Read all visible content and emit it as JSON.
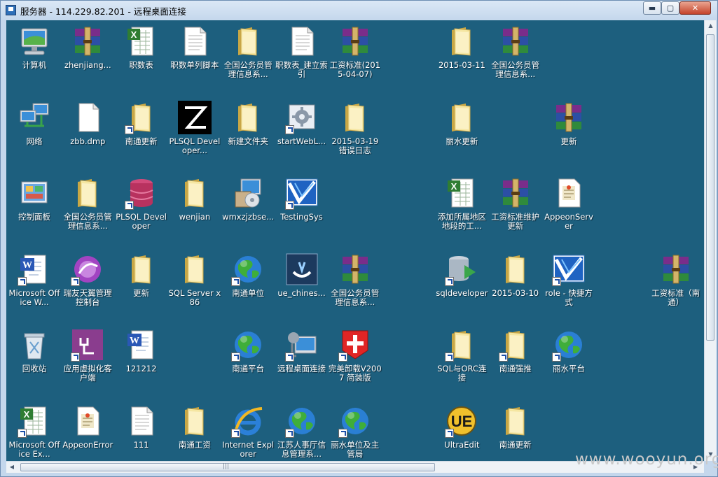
{
  "window": {
    "title": "服务器 - 114.229.82.201 - 远程桌面连接",
    "min_label": "▬",
    "max_label": "▢",
    "close_label": "✕"
  },
  "icons": [
    {
      "label": "计算机",
      "type": "computer",
      "shortcut": false
    },
    {
      "label": "zhenjiang...",
      "type": "rar",
      "shortcut": false
    },
    {
      "label": "职数表",
      "type": "excel",
      "shortcut": false
    },
    {
      "label": "职数单列脚本",
      "type": "doc",
      "shortcut": false
    },
    {
      "label": "全国公务员管理信息系...",
      "type": "folder",
      "shortcut": false
    },
    {
      "label": "职数表_建立索引",
      "type": "doc",
      "shortcut": false
    },
    {
      "label": "工资标准(2015-04-07)",
      "type": "rar",
      "shortcut": false
    },
    {
      "label": "2015-03-11",
      "type": "folder",
      "shortcut": false
    },
    {
      "label": "全国公务员管理信息系...",
      "type": "rar",
      "shortcut": false
    },
    {
      "label": "网络",
      "type": "network",
      "shortcut": false
    },
    {
      "label": "zbb.dmp",
      "type": "blank",
      "shortcut": false
    },
    {
      "label": "南通更新",
      "type": "folder",
      "shortcut": true
    },
    {
      "label": "PLSQL Developer...",
      "type": "plsql",
      "shortcut": false
    },
    {
      "label": "新建文件夹",
      "type": "folder",
      "shortcut": false
    },
    {
      "label": "startWebL...",
      "type": "gear",
      "shortcut": true
    },
    {
      "label": "2015-03-19错误日志",
      "type": "folder",
      "shortcut": false
    },
    {
      "label": "丽水更新",
      "type": "folder",
      "shortcut": false
    },
    {
      "label": "更新",
      "type": "rar",
      "shortcut": false
    },
    {
      "label": "控制面板",
      "type": "panel",
      "shortcut": false
    },
    {
      "label": "全国公务员管理信息系...",
      "type": "folder",
      "shortcut": false
    },
    {
      "label": "PLSQL Developer",
      "type": "database",
      "shortcut": true
    },
    {
      "label": "wenjian",
      "type": "folder",
      "shortcut": false
    },
    {
      "label": "wmxzjzbse...",
      "type": "installer",
      "shortcut": false
    },
    {
      "label": "TestingSys",
      "type": "app",
      "shortcut": true
    },
    {
      "label": "添加所属地区地段的工...",
      "type": "excel",
      "shortcut": false
    },
    {
      "label": "工资标准维护更新",
      "type": "rar",
      "shortcut": false
    },
    {
      "label": "AppeonServer",
      "type": "docfile",
      "shortcut": false
    },
    {
      "label": "Microsoft Office W...",
      "type": "word",
      "shortcut": true
    },
    {
      "label": "瑞友天翼管理控制台",
      "type": "purple",
      "shortcut": true
    },
    {
      "label": "更新",
      "type": "folder",
      "shortcut": false
    },
    {
      "label": "SQL Server x86",
      "type": "folder",
      "shortcut": false
    },
    {
      "label": "南通单位",
      "type": "globe",
      "shortcut": true
    },
    {
      "label": "ue_chines...",
      "type": "ue",
      "shortcut": false
    },
    {
      "label": "全国公务员管理信息系...",
      "type": "rar",
      "shortcut": false
    },
    {
      "label": "sqldeveloper",
      "type": "sqldev",
      "shortcut": true
    },
    {
      "label": "2015-03-10",
      "type": "folder",
      "shortcut": false
    },
    {
      "label": "role - 快捷方式",
      "type": "app",
      "shortcut": true
    },
    {
      "label": "工资标准（南通）",
      "type": "rar",
      "shortcut": false
    },
    {
      "label": "回收站",
      "type": "recycle",
      "shortcut": false
    },
    {
      "label": "应用虚拟化客户端",
      "type": "plug",
      "shortcut": true
    },
    {
      "label": "121212",
      "type": "word",
      "shortcut": false
    },
    {
      "label": "南通平台",
      "type": "globe",
      "shortcut": true
    },
    {
      "label": "远程桌面连接",
      "type": "remote",
      "shortcut": true
    },
    {
      "label": "完美卸载V2007 简装版",
      "type": "redcross",
      "shortcut": true
    },
    {
      "label": "SQL与ORC连接",
      "type": "folder",
      "shortcut": true
    },
    {
      "label": "南通强推",
      "type": "folder",
      "shortcut": true
    },
    {
      "label": "丽水平台",
      "type": "globe",
      "shortcut": true
    },
    {
      "label": "Microsoft Office Ex...",
      "type": "excel",
      "shortcut": true
    },
    {
      "label": "AppeonError",
      "type": "docfile",
      "shortcut": false
    },
    {
      "label": "111",
      "type": "doc",
      "shortcut": false
    },
    {
      "label": "南通工资",
      "type": "folder",
      "shortcut": false
    },
    {
      "label": "Internet Explorer",
      "type": "ie",
      "shortcut": true
    },
    {
      "label": "江苏人事厅信息管理系...",
      "type": "globe",
      "shortcut": true
    },
    {
      "label": "丽水单位及主管局",
      "type": "globe",
      "shortcut": true
    },
    {
      "label": "UltraEdit",
      "type": "uedit",
      "shortcut": true
    },
    {
      "label": "南通更新",
      "type": "folder",
      "shortcut": false
    }
  ],
  "watermark": "www.wooyun.org"
}
